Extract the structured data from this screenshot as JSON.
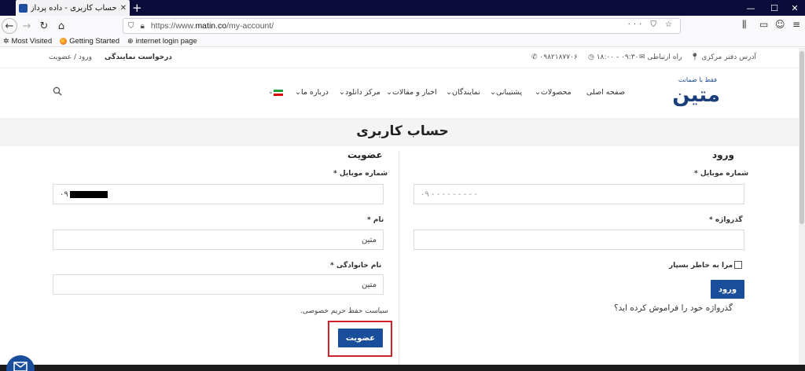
{
  "browser": {
    "tab_title": "حساب کاربری - داده پرداز رایانه مت",
    "url_prefix": "https://www.",
    "url_domain": "matin.co",
    "url_path": "/my-account/",
    "bookmarks": [
      "Most Visited",
      "Getting Started",
      "internet login page"
    ]
  },
  "topbar": {
    "address": "آدرس دفتر مرکزی",
    "contact": "راه ارتباطی",
    "hours": "۱۸:۰۰ - ۰۹:۳۰",
    "phone": "۰۹۸۲۱۸۷۷۰۶",
    "agency_request": "درخواست نمایندگی",
    "login_signup": "ورود / عضویت"
  },
  "header": {
    "logo_tagline": "فقط با ضمانت",
    "logo_text": "متین",
    "menu": [
      "صفحه اصلی",
      "محصولات",
      "پشتیبانی",
      "نمایندگان",
      "اخبار و مقالات",
      "مرکز دانلود",
      "درباره ما"
    ]
  },
  "page": {
    "title": "حساب کاربری"
  },
  "login": {
    "title": "ورود",
    "mobile_label": "شماره موبایل",
    "mobile_placeholder": "۰۹ - - - - - - - - -",
    "password_label": "گذرواژه",
    "remember_label": "مرا به خاطر بسپار",
    "submit": "ورود",
    "forgot": "گذرواژه خود را فراموش کرده اید؟"
  },
  "register": {
    "title": "عضویت",
    "mobile_label": "شماره موبایل",
    "mobile_value": "۰۹",
    "first_name_label": "نام",
    "first_name_value": "متین",
    "last_name_label": "نام خانوادگی",
    "last_name_value": "متین",
    "privacy": "سیاست حفظ حریم خصوصی.",
    "submit": "عضویت"
  },
  "required_mark": "*",
  "colors": {
    "brand": "#1b4e9a",
    "highlight": "#d0202a",
    "tabbar": "#0c0c3a"
  }
}
